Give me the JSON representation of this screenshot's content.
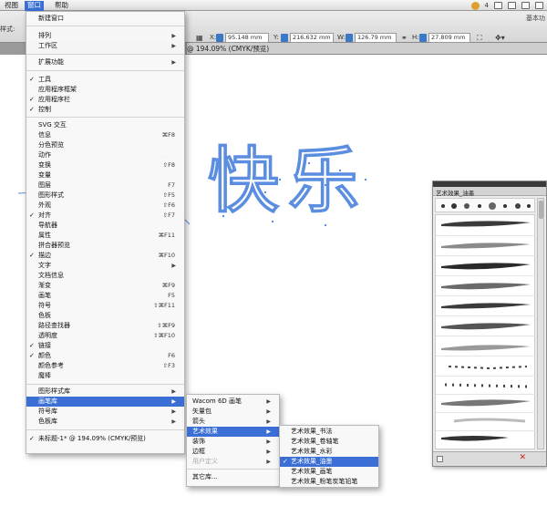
{
  "menubar": {
    "view": "视图",
    "window": "窗口",
    "help": "帮助",
    "right_status": "4",
    "right_essentials": "基本功"
  },
  "control": {
    "label": "样式:",
    "x_value": "95.148 mm",
    "y_value": "216.632 mm",
    "w_value": "126.79 mm",
    "h_value": "27.809 mm"
  },
  "document": {
    "tab_title": "@ 194.09% (CMYK/预览)",
    "artwork_text": "快乐"
  },
  "window_menu": {
    "items": [
      {
        "label": "新建窗口",
        "check": "",
        "shortcut": "",
        "arrow": false
      },
      {
        "label": "排列",
        "check": "",
        "shortcut": "",
        "arrow": true
      },
      {
        "label": "工作区",
        "check": "",
        "shortcut": "",
        "arrow": true
      },
      {
        "label": "扩展功能",
        "check": "",
        "shortcut": "",
        "arrow": true
      },
      {
        "label": "工具",
        "check": "✓",
        "shortcut": "",
        "arrow": false
      },
      {
        "label": "应用程序框架",
        "check": "",
        "shortcut": "",
        "arrow": false
      },
      {
        "label": "应用程序栏",
        "check": "✓",
        "shortcut": "",
        "arrow": false
      },
      {
        "label": "控制",
        "check": "✓",
        "shortcut": "",
        "arrow": false
      },
      {
        "label": "SVG 交互",
        "check": "",
        "shortcut": "",
        "arrow": false
      },
      {
        "label": "信息",
        "check": "",
        "shortcut": "⌘F8",
        "arrow": false
      },
      {
        "label": "分色预览",
        "check": "",
        "shortcut": "",
        "arrow": false
      },
      {
        "label": "动作",
        "check": "",
        "shortcut": "",
        "arrow": false
      },
      {
        "label": "变换",
        "check": "",
        "shortcut": "⇧F8",
        "arrow": false
      },
      {
        "label": "变量",
        "check": "",
        "shortcut": "",
        "arrow": false
      },
      {
        "label": "图层",
        "check": "",
        "shortcut": "F7",
        "arrow": false
      },
      {
        "label": "图形样式",
        "check": "",
        "shortcut": "⇧F5",
        "arrow": false
      },
      {
        "label": "外观",
        "check": "",
        "shortcut": "⇧F6",
        "arrow": false
      },
      {
        "label": "对齐",
        "check": "✓",
        "shortcut": "⇧F7",
        "arrow": false
      },
      {
        "label": "导航器",
        "check": "",
        "shortcut": "",
        "arrow": false
      },
      {
        "label": "属性",
        "check": "",
        "shortcut": "⌘F11",
        "arrow": false
      },
      {
        "label": "拼合器预览",
        "check": "",
        "shortcut": "",
        "arrow": false
      },
      {
        "label": "描边",
        "check": "✓",
        "shortcut": "⌘F10",
        "arrow": false
      },
      {
        "label": "文字",
        "check": "",
        "shortcut": "",
        "arrow": true
      },
      {
        "label": "文档信息",
        "check": "",
        "shortcut": "",
        "arrow": false
      },
      {
        "label": "渐变",
        "check": "",
        "shortcut": "⌘F9",
        "arrow": false
      },
      {
        "label": "画笔",
        "check": "",
        "shortcut": "F5",
        "arrow": false
      },
      {
        "label": "符号",
        "check": "",
        "shortcut": "⇧⌘F11",
        "arrow": false
      },
      {
        "label": "色板",
        "check": "",
        "shortcut": "",
        "arrow": false
      },
      {
        "label": "路径查找器",
        "check": "",
        "shortcut": "⇧⌘F9",
        "arrow": false
      },
      {
        "label": "透明度",
        "check": "",
        "shortcut": "⇧⌘F10",
        "arrow": false
      },
      {
        "label": "链接",
        "check": "✓",
        "shortcut": "",
        "arrow": false
      },
      {
        "label": "颜色",
        "check": "✓",
        "shortcut": "F6",
        "arrow": false
      },
      {
        "label": "颜色参考",
        "check": "",
        "shortcut": "⇧F3",
        "arrow": false
      },
      {
        "label": "魔棒",
        "check": "",
        "shortcut": "",
        "arrow": false
      },
      {
        "label": "图形样式库",
        "check": "",
        "shortcut": "",
        "arrow": true
      },
      {
        "label": "画笔库",
        "check": "",
        "shortcut": "",
        "arrow": true
      },
      {
        "label": "符号库",
        "check": "",
        "shortcut": "",
        "arrow": true
      },
      {
        "label": "色板库",
        "check": "",
        "shortcut": "",
        "arrow": true
      },
      {
        "label": "未标题-1* @ 194.09% (CMYK/预览)",
        "check": "✓",
        "shortcut": "",
        "arrow": false
      }
    ]
  },
  "brush_library_menu": {
    "items": [
      "Wacom 6D 画笔",
      "矢量包",
      "箭头",
      "艺术效果",
      "装饰",
      "边框",
      "用户定义",
      "其它库..."
    ]
  },
  "art_effects_menu": {
    "items": [
      "艺术效果_书法",
      "艺术效果_卷轴笔",
      "艺术效果_水彩",
      "艺术效果_油墨",
      "艺术效果_画笔",
      "艺术效果_粉笔炭笔铅笔"
    ],
    "checked": "✓"
  },
  "brush_panel": {
    "title": "艺术效果_油墨",
    "delete_glyph": "✕"
  }
}
